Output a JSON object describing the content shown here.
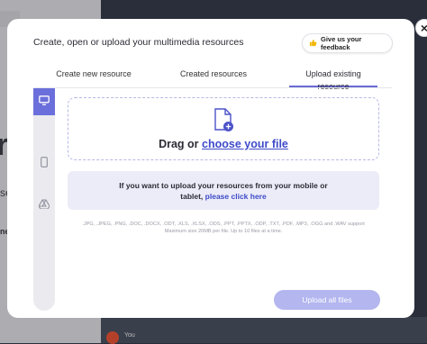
{
  "background": {
    "big_text": "r",
    "fragment_se": "se",
    "fragment_ne": "ne",
    "user_label": "You"
  },
  "modal": {
    "title": "Create, open or upload your multimedia resources",
    "feedback_label": "Give us your feedback",
    "close_glyph": "×",
    "tabs": [
      {
        "label": "Create new resource",
        "active": false
      },
      {
        "label": "Created resources",
        "active": false
      },
      {
        "label": "Upload existing resource",
        "active": true
      }
    ],
    "sidebar": [
      {
        "icon": "monitor-icon",
        "active": true
      },
      {
        "icon": "phone-icon",
        "active": false
      },
      {
        "icon": "drive-icon",
        "active": false
      }
    ],
    "dropzone": {
      "prefix": "Drag or ",
      "link": "choose your file"
    },
    "mobile": {
      "line1": "If you want to upload your resources from your mobile or",
      "line2_prefix": "tablet, ",
      "link": "please click here"
    },
    "formats": {
      "line1": ".JPG, .JPEG, .PNG, .DOC, .DOCX, .ODT, .XLS, .XLSX, .ODS, .PPT, .PPTX, .ODP, .TXT, .PDF, .MP3, .OGG and .WAV support",
      "line2": "Maximum size 20MB per file. Up to 10 files at a time."
    },
    "upload_button": "Upload all files"
  },
  "colors": {
    "accent": "#6b6fdb",
    "link": "#3d4ac9",
    "button_disabled": "#b3b6ef",
    "mobile_box": "#ececf8"
  }
}
